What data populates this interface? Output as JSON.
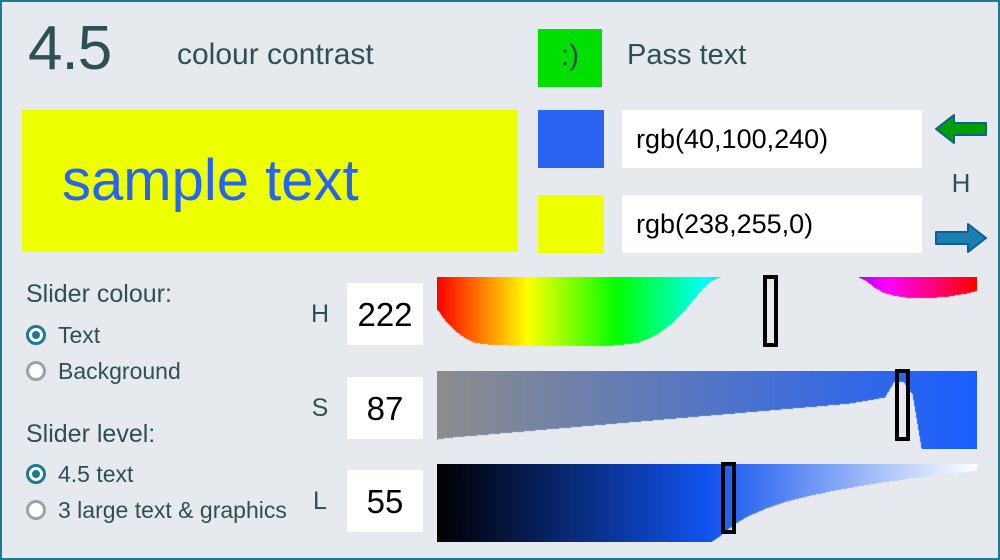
{
  "header": {
    "ratio_value": "4.5",
    "ratio_label": "colour contrast",
    "badge_glyph": ":)",
    "badge_color": "#00e000",
    "pass_label": "Pass text"
  },
  "preview": {
    "sample_text": "sample text",
    "text_color": "rgb(40,100,240)",
    "background_color": "rgb(238,255,0)"
  },
  "colour_fields": [
    {
      "name": "text-colour",
      "swatch_color": "rgb(40,100,240)",
      "value": "rgb(40,100,240)"
    },
    {
      "name": "background-colour",
      "swatch_color": "rgb(238,255,0)",
      "value": "rgb(238,255,0)"
    }
  ],
  "channel_nav": {
    "prev_icon": "arrow-left-icon",
    "prev_color": "#00a000",
    "current_channel": "H",
    "next_icon": "arrow-right-icon",
    "next_color": "#1b7fb0"
  },
  "options": {
    "slider_colour": {
      "title": "Slider colour:",
      "items": [
        {
          "label": "Text",
          "selected": true
        },
        {
          "label": "Background",
          "selected": false
        }
      ]
    },
    "slider_level": {
      "title": "Slider level:",
      "items": [
        {
          "label": "4.5 text",
          "selected": true
        },
        {
          "label": "3 large text & graphics",
          "selected": false
        }
      ]
    }
  },
  "sliders": [
    {
      "channel": "H",
      "value": "222",
      "min": 0,
      "max": 360,
      "thumb_fraction": 0.617,
      "track_kind": "hue",
      "profile": [
        0.42,
        0.58,
        0.7,
        0.78,
        0.84,
        0.86,
        0.87,
        0.87,
        0.88,
        0.88,
        0.89,
        0.89,
        0.89,
        0.89,
        0.89,
        0.89,
        0.89,
        0.89,
        0.88,
        0.88,
        0.87,
        0.86,
        0.84,
        0.8,
        0.74,
        0.66,
        0.56,
        0.44,
        0.3,
        0.16,
        0.05,
        0.0,
        0.0,
        0.0,
        0.0,
        0.0,
        0.0,
        0.0,
        0.0,
        0.0,
        0.0,
        0.0,
        0.0,
        0.0,
        0.0,
        0.0,
        0.0,
        0.06,
        0.15,
        0.21,
        0.24,
        0.26,
        0.27,
        0.27,
        0.27,
        0.26,
        0.25,
        0.23,
        0.21,
        0.18
      ]
    },
    {
      "channel": "S",
      "value": "87",
      "min": 0,
      "max": 100,
      "thumb_fraction": 0.862,
      "track_kind": "saturation",
      "profile": [
        0.88,
        0.86,
        0.85,
        0.84,
        0.83,
        0.82,
        0.81,
        0.8,
        0.79,
        0.78,
        0.77,
        0.76,
        0.75,
        0.74,
        0.73,
        0.72,
        0.71,
        0.7,
        0.69,
        0.68,
        0.67,
        0.66,
        0.65,
        0.64,
        0.63,
        0.62,
        0.61,
        0.6,
        0.59,
        0.58,
        0.57,
        0.56,
        0.55,
        0.54,
        0.53,
        0.52,
        0.51,
        0.5,
        0.49,
        0.48,
        0.47,
        0.46,
        0.45,
        0.44,
        0.43,
        0.42,
        0.4,
        0.38,
        0.36,
        0.34,
        0.14,
        0.14,
        0.3,
        1.0,
        1.0,
        1.0,
        1.0,
        1.0,
        1.0,
        1.0
      ]
    },
    {
      "channel": "L",
      "value": "55",
      "min": 0,
      "max": 100,
      "thumb_fraction": 0.538,
      "track_kind": "lightness",
      "profile": [
        1.0,
        1.0,
        1.0,
        1.0,
        1.0,
        1.0,
        1.0,
        1.0,
        1.0,
        1.0,
        1.0,
        1.0,
        1.0,
        1.0,
        1.0,
        1.0,
        1.0,
        1.0,
        1.0,
        1.0,
        1.0,
        1.0,
        1.0,
        1.0,
        1.0,
        1.0,
        1.0,
        1.0,
        1.0,
        1.0,
        1.0,
        0.92,
        0.82,
        0.74,
        0.67,
        0.62,
        0.57,
        0.53,
        0.49,
        0.46,
        0.43,
        0.4,
        0.38,
        0.35,
        0.33,
        0.31,
        0.29,
        0.27,
        0.25,
        0.23,
        0.22,
        0.2,
        0.18,
        0.17,
        0.15,
        0.14,
        0.12,
        0.11,
        0.1,
        0.08
      ]
    }
  ],
  "theme": {
    "page_background": "#e6eaee",
    "border_color": "#1b7a94",
    "text_color": "#2e5052",
    "accent_color": "#1b7a94"
  }
}
